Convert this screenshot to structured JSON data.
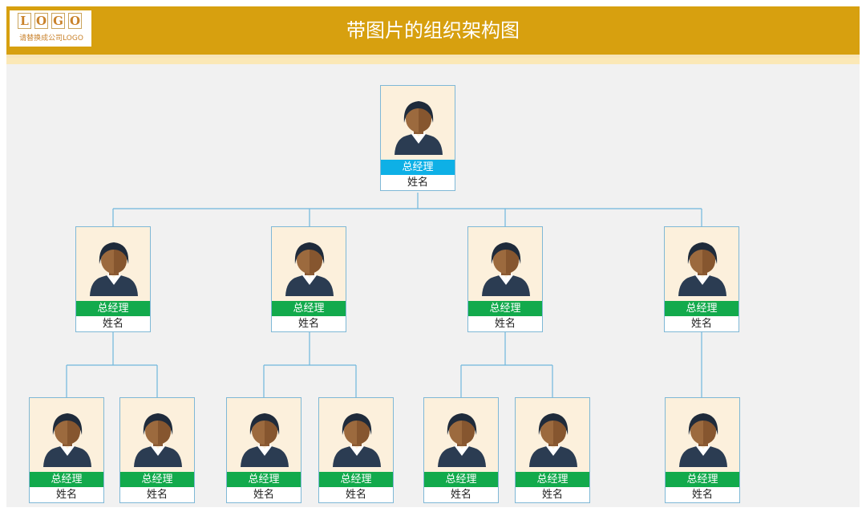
{
  "header": {
    "title": "带图片的组织架构图",
    "logo_letters": [
      "L",
      "O",
      "G",
      "O"
    ],
    "logo_subtitle": "请替换成公司LOGO"
  },
  "colors": {
    "header_bg": "#d7a00f",
    "top_role_bg": "#0eb0e6",
    "role_bg": "#12aa4c",
    "connector": "#6fb7dd",
    "photo_bg": "#fcf0dc"
  },
  "org": {
    "top": {
      "role": "总经理",
      "name": "姓名",
      "icon": "person-avatar-icon"
    },
    "level2": [
      {
        "role": "总经理",
        "name": "姓名",
        "icon": "person-avatar-icon"
      },
      {
        "role": "总经理",
        "name": "姓名",
        "icon": "person-avatar-icon"
      },
      {
        "role": "总经理",
        "name": "姓名",
        "icon": "person-avatar-icon"
      },
      {
        "role": "总经理",
        "name": "姓名",
        "icon": "person-avatar-icon"
      }
    ],
    "level3": [
      {
        "role": "总经理",
        "name": "姓名",
        "icon": "person-avatar-icon"
      },
      {
        "role": "总经理",
        "name": "姓名",
        "icon": "person-avatar-icon"
      },
      {
        "role": "总经理",
        "name": "姓名",
        "icon": "person-avatar-icon"
      },
      {
        "role": "总经理",
        "name": "姓名",
        "icon": "person-avatar-icon"
      },
      {
        "role": "总经理",
        "name": "姓名",
        "icon": "person-avatar-icon"
      },
      {
        "role": "总经理",
        "name": "姓名",
        "icon": "person-avatar-icon"
      },
      {
        "role": "总经理",
        "name": "姓名",
        "icon": "person-avatar-icon"
      }
    ]
  }
}
